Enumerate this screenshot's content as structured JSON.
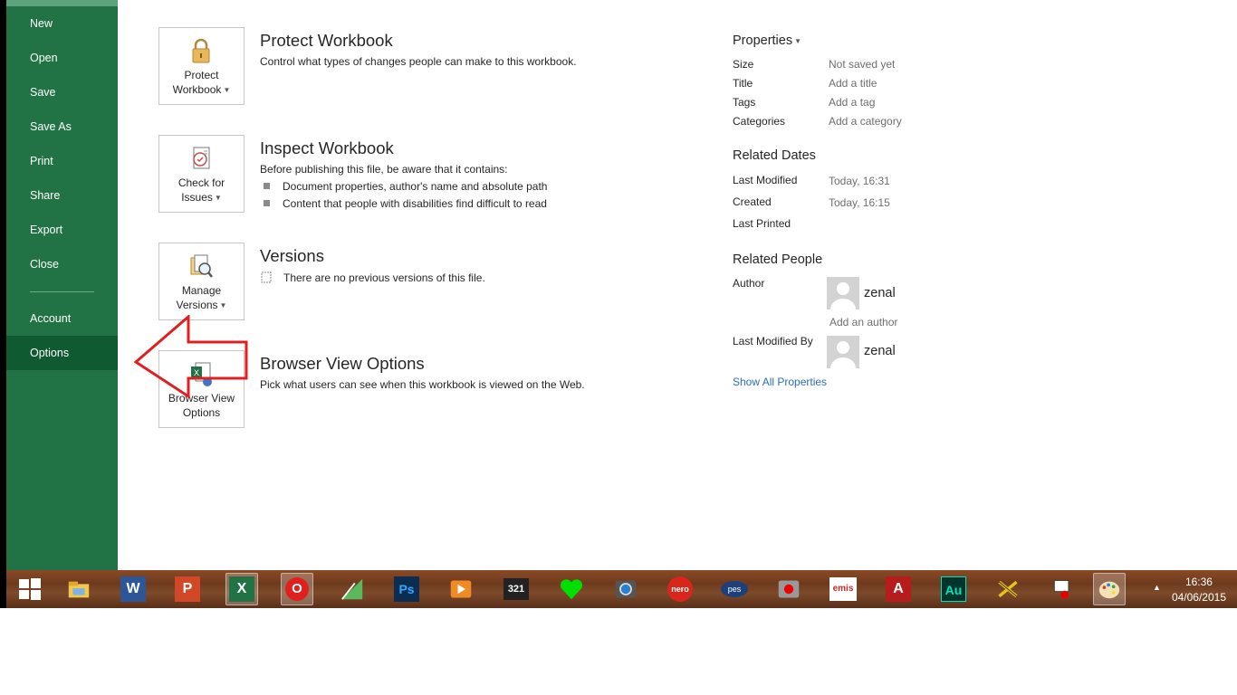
{
  "sidebar": {
    "items": [
      {
        "label": "New"
      },
      {
        "label": "Open"
      },
      {
        "label": "Save"
      },
      {
        "label": "Save As"
      },
      {
        "label": "Print"
      },
      {
        "label": "Share"
      },
      {
        "label": "Export"
      },
      {
        "label": "Close"
      },
      {
        "label": "Account"
      },
      {
        "label": "Options"
      }
    ],
    "selected": "Options"
  },
  "sections": {
    "protect": {
      "tile_line1": "Protect",
      "tile_line2": "Workbook",
      "title": "Protect Workbook",
      "desc": "Control what types of changes people can make to this workbook."
    },
    "inspect": {
      "tile_line1": "Check for",
      "tile_line2": "Issues",
      "title": "Inspect Workbook",
      "desc": "Before publishing this file, be aware that it contains:",
      "bullets": [
        "Document properties, author's name and absolute path",
        "Content that people with disabilities find difficult to read"
      ]
    },
    "versions": {
      "tile_line1": "Manage",
      "tile_line2": "Versions",
      "title": "Versions",
      "desc": "There are no previous versions of this file."
    },
    "browser": {
      "tile_line1": "Browser View",
      "tile_line2": "Options",
      "title": "Browser View Options",
      "desc": "Pick what users can see when this workbook is viewed on the Web."
    }
  },
  "properties": {
    "heading": "Properties",
    "rows": [
      {
        "key": "Size",
        "value": "Not saved yet"
      },
      {
        "key": "Title",
        "value": "Add a title"
      },
      {
        "key": "Tags",
        "value": "Add a tag"
      },
      {
        "key": "Categories",
        "value": "Add a category"
      }
    ],
    "related_dates": {
      "heading": "Related Dates",
      "rows": [
        {
          "key": "Last Modified",
          "value": "Today, 16:31"
        },
        {
          "key": "Created",
          "value": "Today, 16:15"
        },
        {
          "key": "Last Printed",
          "value": ""
        }
      ]
    },
    "related_people": {
      "heading": "Related People",
      "author_label": "Author",
      "author_name": "zenal",
      "add_author": "Add an author",
      "last_modified_by_label": "Last Modified By",
      "last_modified_by_name": "zenal"
    },
    "show_all": "Show All Properties"
  },
  "taskbar": {
    "apps": [
      {
        "name": "start-icon"
      },
      {
        "name": "file-explorer-icon"
      },
      {
        "name": "word-icon",
        "label": "W"
      },
      {
        "name": "powerpoint-icon",
        "label": "P"
      },
      {
        "name": "excel-icon",
        "label": "X"
      },
      {
        "name": "opera-icon",
        "label": "O"
      },
      {
        "name": "coreldraw-icon"
      },
      {
        "name": "photoshop-icon",
        "label": "Ps"
      },
      {
        "name": "media-player-icon"
      },
      {
        "name": "media-player-classic-icon",
        "label": "321"
      },
      {
        "name": "green-heart-icon"
      },
      {
        "name": "camera-icon"
      },
      {
        "name": "nero-icon",
        "label": "nero"
      },
      {
        "name": "pes-galaxy-icon",
        "label": "pes"
      },
      {
        "name": "record-icon"
      },
      {
        "name": "emis-icon",
        "label": "emis"
      },
      {
        "name": "autocad-icon",
        "label": "A"
      },
      {
        "name": "audition-icon",
        "label": "Au"
      },
      {
        "name": "app-x-icon"
      },
      {
        "name": "display-icon"
      },
      {
        "name": "paint-icon"
      }
    ],
    "time": "16:36",
    "date": "04/06/2015"
  },
  "colors": {
    "sidebar": "#217346",
    "sidebar_selected": "#0f5a31",
    "link": "#2a6ebb",
    "arrow": "#e02020"
  }
}
